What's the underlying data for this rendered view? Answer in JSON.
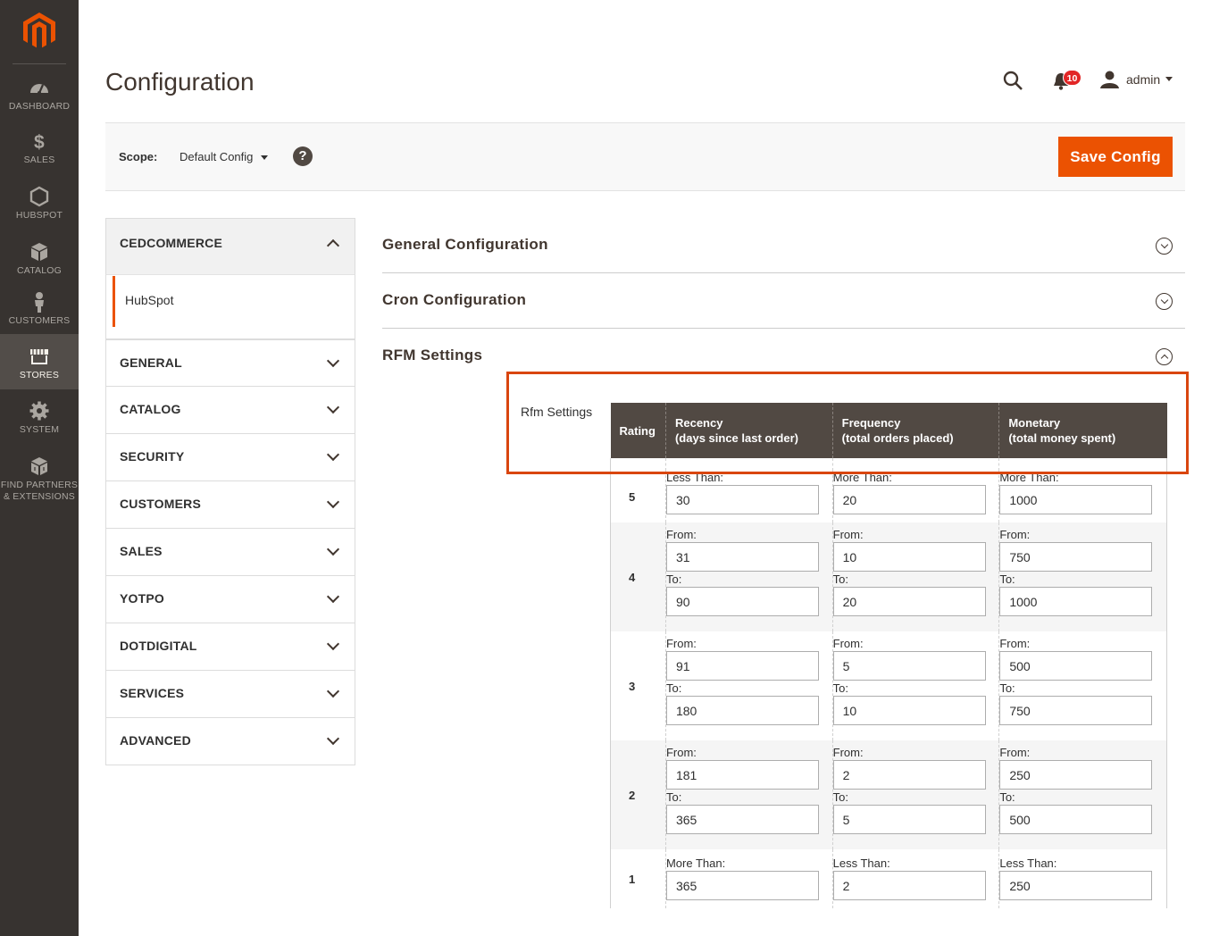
{
  "nav": {
    "items": [
      {
        "label": "DASHBOARD",
        "icon": "dashboard-icon"
      },
      {
        "label": "SALES",
        "icon": "dollar-icon"
      },
      {
        "label": "HUBSPOT",
        "icon": "hexagon-icon"
      },
      {
        "label": "CATALOG",
        "icon": "box-icon"
      },
      {
        "label": "CUSTOMERS",
        "icon": "person-icon"
      },
      {
        "label": "STORES",
        "icon": "store-icon",
        "active": true
      },
      {
        "label": "SYSTEM",
        "icon": "gear-icon"
      },
      {
        "label": "FIND PARTNERS",
        "label2": "& EXTENSIONS",
        "icon": "blocks-icon"
      }
    ]
  },
  "header": {
    "title": "Configuration",
    "notifications_count": "10",
    "user_name": "admin"
  },
  "scope": {
    "label": "Scope:",
    "value": "Default Config",
    "help": "?",
    "save_label": "Save Config"
  },
  "tabs": {
    "group": "CEDCOMMERCE",
    "sub_item": "HubSpot",
    "items": [
      "GENERAL",
      "CATALOG",
      "SECURITY",
      "CUSTOMERS",
      "SALES",
      "YOTPO",
      "DOTDIGITAL",
      "SERVICES",
      "ADVANCED"
    ]
  },
  "sections": {
    "general": "General Configuration",
    "cron": "Cron Configuration",
    "rfm": "RFM Settings"
  },
  "rfm": {
    "field_label": "Rfm Settings",
    "headers": {
      "rating": "Rating",
      "recency": "Recency",
      "recency_sub": "(days since last order)",
      "frequency": "Frequency",
      "frequency_sub": "(total orders placed)",
      "monetary": "Monetary",
      "monetary_sub": "(total money spent)"
    },
    "rows": [
      {
        "rating": "5",
        "recency": {
          "l1": "Less Than:",
          "v1": "30"
        },
        "frequency": {
          "l1": "More Than:",
          "v1": "20"
        },
        "monetary": {
          "l1": "More Than:",
          "v1": "1000"
        }
      },
      {
        "rating": "4",
        "recency": {
          "l1": "From:",
          "v1": "31",
          "l2": "To:",
          "v2": "90"
        },
        "frequency": {
          "l1": "From:",
          "v1": "10",
          "l2": "To:",
          "v2": "20"
        },
        "monetary": {
          "l1": "From:",
          "v1": "750",
          "l2": "To:",
          "v2": "1000"
        }
      },
      {
        "rating": "3",
        "recency": {
          "l1": "From:",
          "v1": "91",
          "l2": "To:",
          "v2": "180"
        },
        "frequency": {
          "l1": "From:",
          "v1": "5",
          "l2": "To:",
          "v2": "10"
        },
        "monetary": {
          "l1": "From:",
          "v1": "500",
          "l2": "To:",
          "v2": "750"
        }
      },
      {
        "rating": "2",
        "recency": {
          "l1": "From:",
          "v1": "181",
          "l2": "To:",
          "v2": "365"
        },
        "frequency": {
          "l1": "From:",
          "v1": "2",
          "l2": "To:",
          "v2": "5"
        },
        "monetary": {
          "l1": "From:",
          "v1": "250",
          "l2": "To:",
          "v2": "500"
        }
      },
      {
        "rating": "1",
        "recency": {
          "l1": "More Than:",
          "v1": "365"
        },
        "frequency": {
          "l1": "Less Than:",
          "v1": "2"
        },
        "monetary": {
          "l1": "Less Than:",
          "v1": "250"
        }
      }
    ]
  },
  "colors": {
    "accent": "#eb5202",
    "nav_bg": "#373330",
    "table_header": "#514943",
    "highlight_box": "#d9460f"
  }
}
